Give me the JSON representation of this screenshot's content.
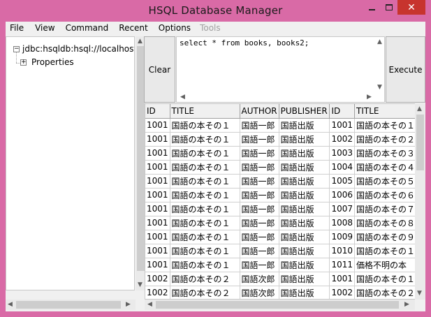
{
  "window": {
    "title": "HSQL Database Manager",
    "close_glyph": "✕"
  },
  "menu": [
    {
      "label": "File",
      "enabled": true
    },
    {
      "label": "View",
      "enabled": true
    },
    {
      "label": "Command",
      "enabled": true
    },
    {
      "label": "Recent",
      "enabled": true
    },
    {
      "label": "Options",
      "enabled": true
    },
    {
      "label": "Tools",
      "enabled": false
    }
  ],
  "tree": {
    "root_label": "jdbc:hsqldb:hsql://localhost/",
    "root_expander": "−",
    "child_label": "Properties",
    "child_expander": "+"
  },
  "sql": {
    "clear_label": "Clear",
    "execute_label": "Execute",
    "query": "select * from books, books2;"
  },
  "grid": {
    "columns": [
      "ID",
      "TITLE",
      "AUTHOR",
      "PUBLISHER",
      "ID",
      "TITLE"
    ],
    "rows": [
      [
        "1001",
        "国語の本その１",
        "国語一郎",
        "国語出版",
        "1001",
        "国語の本その１"
      ],
      [
        "1001",
        "国語の本その１",
        "国語一郎",
        "国語出版",
        "1002",
        "国語の本その２"
      ],
      [
        "1001",
        "国語の本その１",
        "国語一郎",
        "国語出版",
        "1003",
        "国語の本その３"
      ],
      [
        "1001",
        "国語の本その１",
        "国語一郎",
        "国語出版",
        "1004",
        "国語の本その４"
      ],
      [
        "1001",
        "国語の本その１",
        "国語一郎",
        "国語出版",
        "1005",
        "国語の本その５"
      ],
      [
        "1001",
        "国語の本その１",
        "国語一郎",
        "国語出版",
        "1006",
        "国語の本その６"
      ],
      [
        "1001",
        "国語の本その１",
        "国語一郎",
        "国語出版",
        "1007",
        "国語の本その７"
      ],
      [
        "1001",
        "国語の本その１",
        "国語一郎",
        "国語出版",
        "1008",
        "国語の本その８"
      ],
      [
        "1001",
        "国語の本その１",
        "国語一郎",
        "国語出版",
        "1009",
        "国語の本その９"
      ],
      [
        "1001",
        "国語の本その１",
        "国語一郎",
        "国語出版",
        "1010",
        "国語の本その１"
      ],
      [
        "1001",
        "国語の本その１",
        "国語一郎",
        "国語出版",
        "1011",
        "価格不明の本"
      ],
      [
        "1002",
        "国語の本その２",
        "国語次郎",
        "国語出版",
        "1001",
        "国語の本その１"
      ],
      [
        "1002",
        "国語の本その２",
        "国語次郎",
        "国語出版",
        "1002",
        "国語の本その２"
      ]
    ]
  },
  "scroll": {
    "up": "▲",
    "down": "▼",
    "left": "◀",
    "right": "▶"
  },
  "colors": {
    "title_bar": "#d96aa6",
    "close_button": "#c7342e"
  }
}
